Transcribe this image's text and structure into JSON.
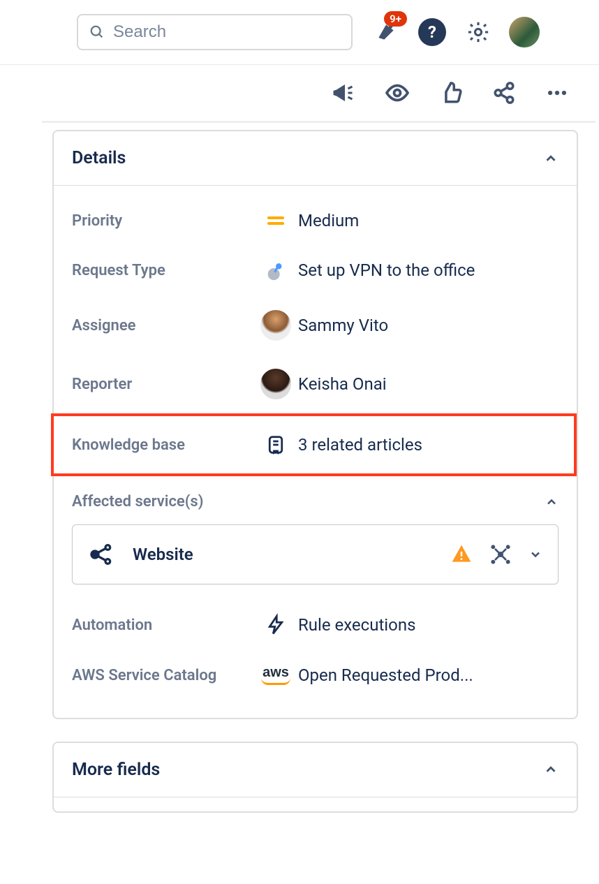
{
  "topbar": {
    "search_placeholder": "Search",
    "notification_badge": "9+"
  },
  "details": {
    "panel_title": "Details",
    "fields": {
      "priority": {
        "label": "Priority",
        "value": "Medium"
      },
      "request_type": {
        "label": "Request Type",
        "value": "Set up VPN to the office"
      },
      "assignee": {
        "label": "Assignee",
        "value": "Sammy Vito"
      },
      "reporter": {
        "label": "Reporter",
        "value": "Keisha Onai"
      },
      "knowledge_base": {
        "label": "Knowledge base",
        "value": "3 related articles"
      },
      "affected_services": {
        "label": "Affected service(s)"
      },
      "automation": {
        "label": "Automation",
        "value": "Rule executions"
      },
      "aws": {
        "label": "AWS Service Catalog",
        "value": "Open Requested Prod..."
      }
    },
    "service": {
      "name": "Website"
    }
  },
  "more_fields": {
    "title": "More fields"
  }
}
